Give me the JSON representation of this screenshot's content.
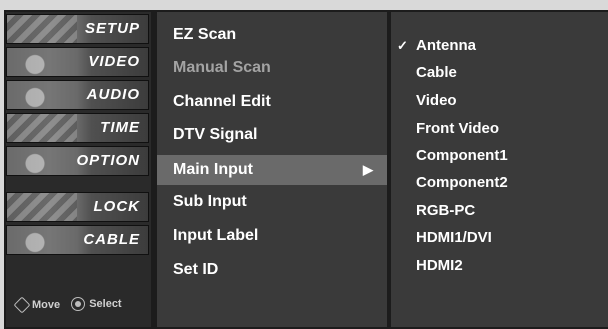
{
  "categories": [
    {
      "label": "SETUP",
      "icon": "setup-icon"
    },
    {
      "label": "VIDEO",
      "icon": "video-icon"
    },
    {
      "label": "AUDIO",
      "icon": "audio-icon"
    },
    {
      "label": "TIME",
      "icon": "time-icon"
    },
    {
      "label": "OPTION",
      "icon": "option-icon"
    },
    {
      "label": "LOCK",
      "icon": "lock-icon"
    },
    {
      "label": "CABLE",
      "icon": "cable-icon"
    }
  ],
  "hint": {
    "move": "Move",
    "select": "Select"
  },
  "submenu": [
    {
      "label": "EZ Scan",
      "state": "normal"
    },
    {
      "label": "Manual Scan",
      "state": "disabled"
    },
    {
      "label": "Channel Edit",
      "state": "normal"
    },
    {
      "label": "DTV Signal",
      "state": "normal"
    },
    {
      "label": "Main Input",
      "state": "active",
      "arrow": "▶"
    },
    {
      "label": "Sub Input",
      "state": "normal"
    },
    {
      "label": "Input Label",
      "state": "normal"
    },
    {
      "label": "Set ID",
      "state": "normal"
    }
  ],
  "options": {
    "selected_mark": "✓",
    "items": [
      "Antenna",
      "Cable",
      "Video",
      "Front Video",
      "Component1",
      "Component2",
      "RGB-PC",
      "HDMI1/DVI",
      "HDMI2"
    ],
    "selected_index": 0
  }
}
